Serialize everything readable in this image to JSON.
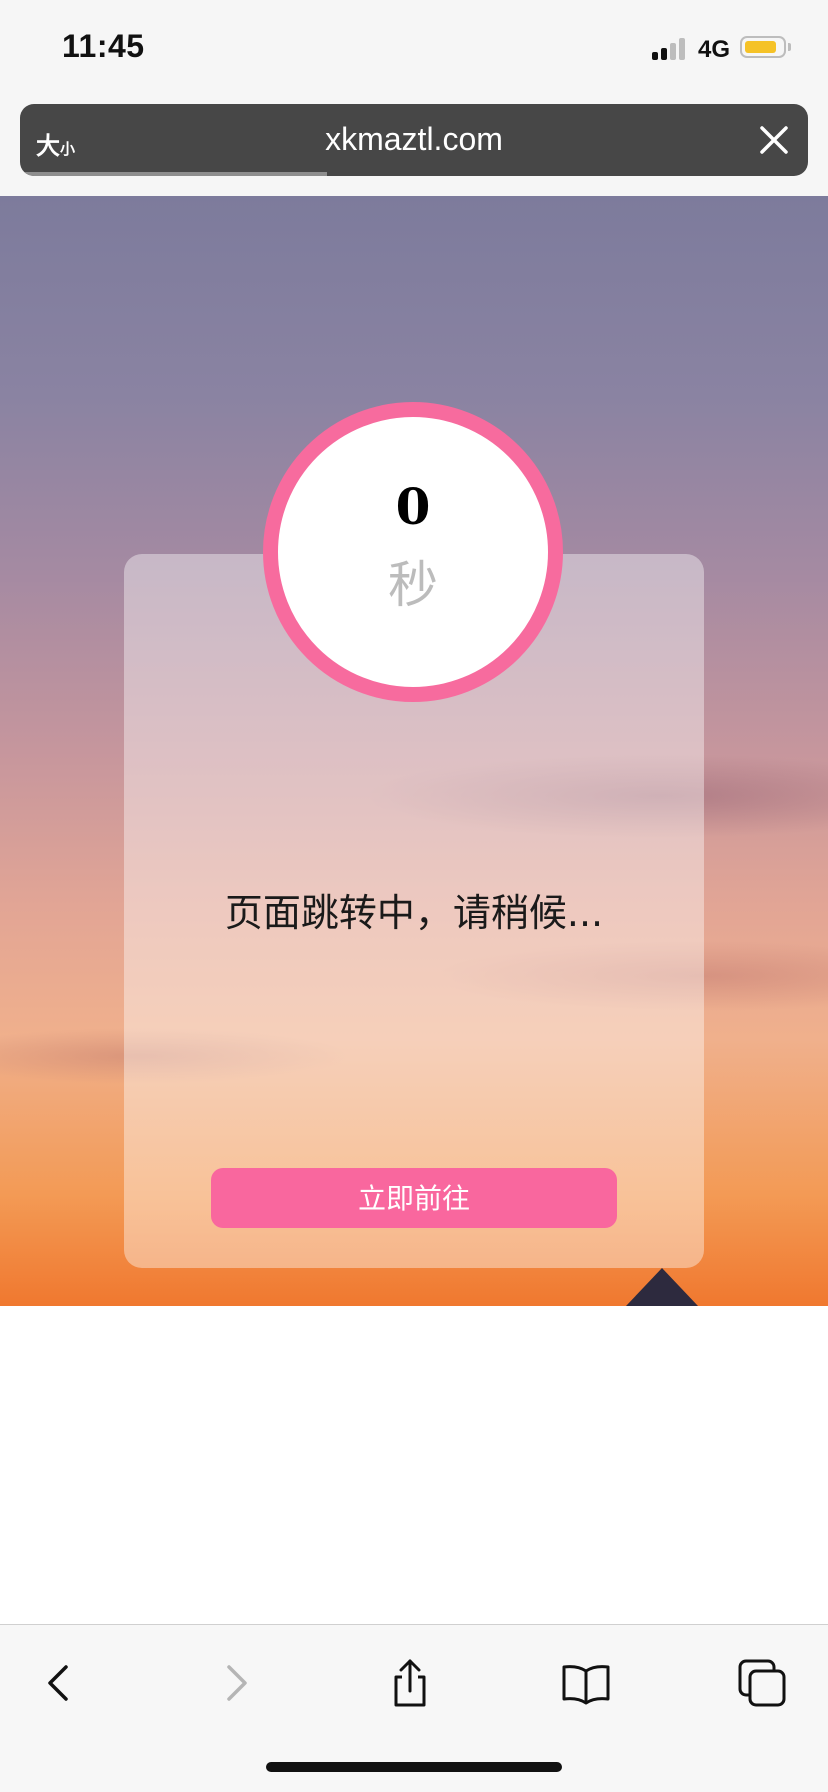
{
  "status_bar": {
    "time": "11:45",
    "network": "4G",
    "battery_level": 0.85,
    "signal_bars": 2
  },
  "url_bar": {
    "text_size_large": "大",
    "text_size_small": "小",
    "url": "xkmaztl.com",
    "load_progress": 0.39
  },
  "page": {
    "countdown_value": "0",
    "countdown_unit": "秒",
    "message": "页面跳转中，请稍候...",
    "go_button_label": "立即前往"
  },
  "toolbar": {
    "icons": [
      "back-icon",
      "forward-icon",
      "share-icon",
      "bookmarks-icon",
      "tabs-icon"
    ]
  },
  "colors": {
    "accent_pink": "#f76b9e",
    "url_bar_bg": "#474747"
  }
}
